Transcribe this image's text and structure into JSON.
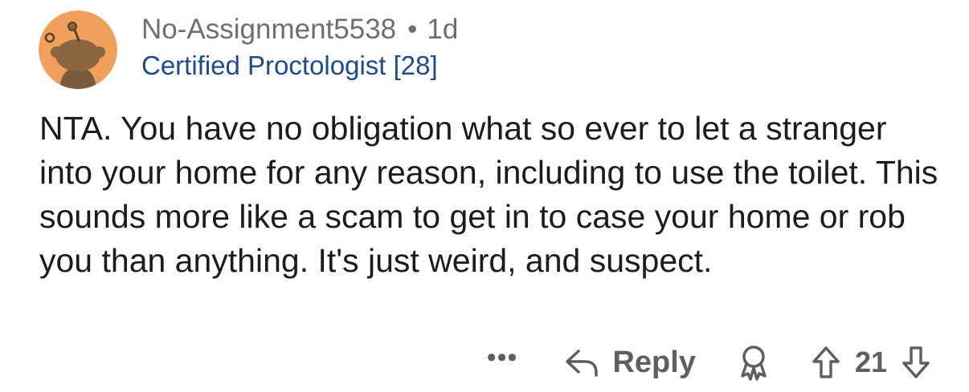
{
  "comment": {
    "username": "No-Assignment5538",
    "separator": "•",
    "age": "1d",
    "flair": "Certified Proctologist [28]",
    "body": "NTA. You have no obligation what so ever to let a stranger into your home for any reason, including to use the toilet. This sounds more like a scam to get in to case your home or rob you than anything. It's just weird, and suspect."
  },
  "avatar": {
    "icon": "snoo-avatar-icon",
    "background_color": "#f0a05a",
    "figure_color": "#8b6540"
  },
  "actions": {
    "more_label": "•••",
    "reply_label": "Reply",
    "reply_icon": "reply-arrow-icon",
    "award_icon": "award-icon",
    "upvote_icon": "upvote-arrow-icon",
    "score": "21",
    "downvote_icon": "downvote-arrow-icon"
  },
  "colors": {
    "meta_gray": "#6f6f6f",
    "flair_blue": "#1f4a8c",
    "body_text": "#1c1c1c",
    "action_gray": "#5f5f5f"
  }
}
